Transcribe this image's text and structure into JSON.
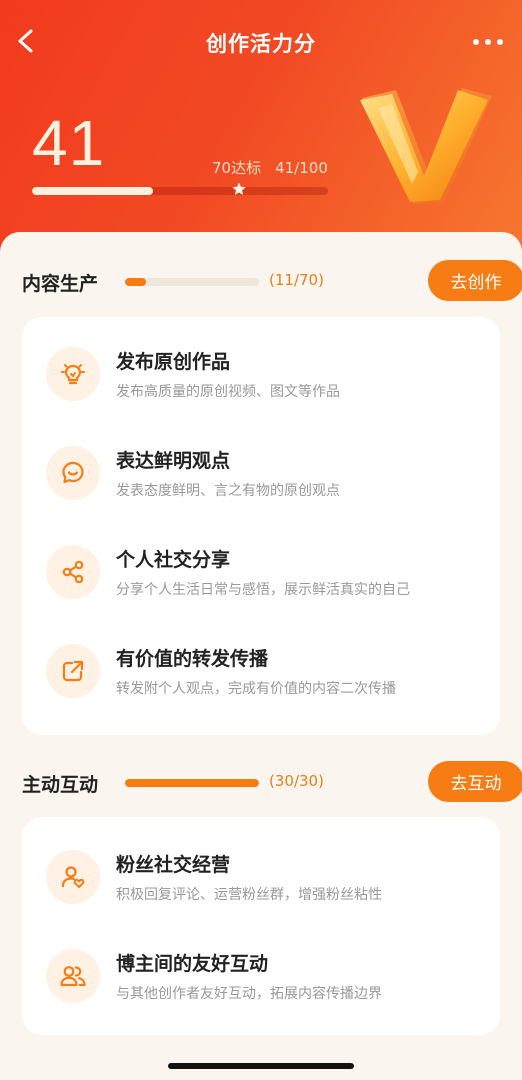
{
  "nav": {
    "title": "创作活力分"
  },
  "score": {
    "value": "41",
    "target_label": "70达标",
    "progress_text": "41/100",
    "progress_fraction": 0.41
  },
  "sections": [
    {
      "title": "内容生产",
      "count_text": "(11/70)",
      "progress_fraction": 0.157,
      "button_label": "去创作",
      "items": [
        {
          "icon": "lightbulb-icon",
          "title": "发布原创作品",
          "desc": "发布高质量的原创视频、图文等作品"
        },
        {
          "icon": "chat-bubble-icon",
          "title": "表达鲜明观点",
          "desc": "发表态度鲜明、言之有物的原创观点"
        },
        {
          "icon": "share-icon",
          "title": "个人社交分享",
          "desc": "分享个人生活日常与感悟，展示鲜活真实的自己"
        },
        {
          "icon": "forward-icon",
          "title": "有价值的转发传播",
          "desc": "转发附个人观点，完成有价值的内容二次传播"
        }
      ]
    },
    {
      "title": "主动互动",
      "count_text": "(30/30)",
      "progress_fraction": 1.0,
      "button_label": "去互动",
      "items": [
        {
          "icon": "user-heart-icon",
          "title": "粉丝社交经营",
          "desc": "积极回复评论、运营粉丝群，增强粉丝粘性"
        },
        {
          "icon": "users-icon",
          "title": "博主间的友好互动",
          "desc": "与其他创作者友好互动，拓展内容传播边界"
        }
      ]
    }
  ],
  "colors": {
    "accent": "#f77c14",
    "hero_start": "#f23a1e",
    "hero_end": "#f77a30",
    "icon_bg": "#fff1e3"
  }
}
